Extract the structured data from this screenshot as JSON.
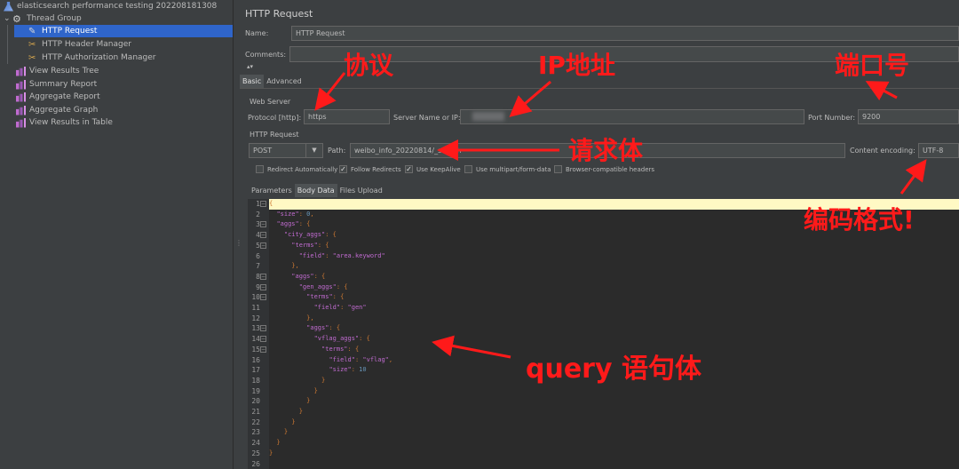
{
  "tree": {
    "items": [
      {
        "label": "elasticsearch performance testing 202208181308",
        "icon": "flask-icon",
        "level": 0,
        "selected": false
      },
      {
        "label": "Thread Group",
        "icon": "gear-icon",
        "level": 0,
        "selected": false
      },
      {
        "label": "HTTP Request",
        "icon": "pen-icon",
        "level": 1,
        "selected": true
      },
      {
        "label": "HTTP Header Manager",
        "icon": "tools-icon",
        "level": 1,
        "selected": false
      },
      {
        "label": "HTTP Authorization Manager",
        "icon": "tools-icon",
        "level": 1,
        "selected": false
      },
      {
        "label": "View Results Tree",
        "icon": "graph-icon",
        "level": 0,
        "selected": false
      },
      {
        "label": "Summary Report",
        "icon": "graph-icon",
        "level": 0,
        "selected": false
      },
      {
        "label": "Aggregate Report",
        "icon": "graph-icon",
        "level": 0,
        "selected": false
      },
      {
        "label": "Aggregate Graph",
        "icon": "graph-icon",
        "level": 0,
        "selected": false
      },
      {
        "label": "View Results in Table",
        "icon": "graph-icon",
        "level": 0,
        "selected": false
      }
    ]
  },
  "panel": {
    "title": "HTTP Request",
    "name_label": "Name:",
    "name_value": "HTTP Request",
    "comments_label": "Comments:",
    "comments_value": "",
    "tabs": [
      "Basic",
      "Advanced"
    ],
    "web_server_label": "Web Server",
    "protocol_label": "Protocol [http]:",
    "protocol_value": "https",
    "server_label": "Server Name or IP:",
    "server_value": "",
    "port_label": "Port Number:",
    "port_value": "9200",
    "http_request_label": "HTTP Request",
    "method_value": "POST",
    "path_label": "Path:",
    "path_value": "weibo_info_20220814/_search",
    "encoding_label": "Content encoding:",
    "encoding_value": "UTF-8",
    "checkboxes": [
      {
        "label": "Redirect Automatically",
        "checked": false
      },
      {
        "label": "Follow Redirects",
        "checked": true
      },
      {
        "label": "Use KeepAlive",
        "checked": true
      },
      {
        "label": "Use multipart/form-data",
        "checked": false
      },
      {
        "label": "Browser-compatible headers",
        "checked": false
      }
    ],
    "body_tabs": [
      "Parameters",
      "Body Data",
      "Files Upload"
    ]
  },
  "editor": {
    "lines": [
      {
        "n": "1",
        "fold": true,
        "text": "{"
      },
      {
        "n": "2",
        "fold": false,
        "text": "  \"size\": 0,"
      },
      {
        "n": "3",
        "fold": true,
        "text": "  \"aggs\": {"
      },
      {
        "n": "4",
        "fold": true,
        "text": "    \"city_aggs\": {"
      },
      {
        "n": "5",
        "fold": true,
        "text": "      \"terms\": {"
      },
      {
        "n": "6",
        "fold": false,
        "text": "        \"field\": \"area.keyword\""
      },
      {
        "n": "7",
        "fold": false,
        "text": "      },"
      },
      {
        "n": "8",
        "fold": true,
        "text": "      \"aggs\": {"
      },
      {
        "n": "9",
        "fold": true,
        "text": "        \"gen_aggs\": {"
      },
      {
        "n": "10",
        "fold": true,
        "text": "          \"terms\": {"
      },
      {
        "n": "11",
        "fold": false,
        "text": "            \"field\": \"gen\""
      },
      {
        "n": "12",
        "fold": false,
        "text": "          },"
      },
      {
        "n": "13",
        "fold": true,
        "text": "          \"aggs\": {"
      },
      {
        "n": "14",
        "fold": true,
        "text": "            \"vflag_aggs\": {"
      },
      {
        "n": "15",
        "fold": true,
        "text": "              \"terms\": {"
      },
      {
        "n": "16",
        "fold": false,
        "text": "                \"field\": \"vflag\","
      },
      {
        "n": "17",
        "fold": false,
        "text": "                \"size\": 10"
      },
      {
        "n": "18",
        "fold": false,
        "text": "              }"
      },
      {
        "n": "19",
        "fold": false,
        "text": "            }"
      },
      {
        "n": "20",
        "fold": false,
        "text": "          }"
      },
      {
        "n": "21",
        "fold": false,
        "text": "        }"
      },
      {
        "n": "22",
        "fold": false,
        "text": "      }"
      },
      {
        "n": "23",
        "fold": false,
        "text": "    }"
      },
      {
        "n": "24",
        "fold": false,
        "text": "  }"
      },
      {
        "n": "25",
        "fold": false,
        "text": "}"
      },
      {
        "n": "26",
        "fold": false,
        "text": ""
      }
    ]
  },
  "annotations": {
    "protocol": "协议",
    "ip": "IP地址",
    "port": "端口号",
    "body": "请求体",
    "encoding": "编码格式!",
    "query": "query 语句体",
    "color": "#ff1a1a"
  }
}
